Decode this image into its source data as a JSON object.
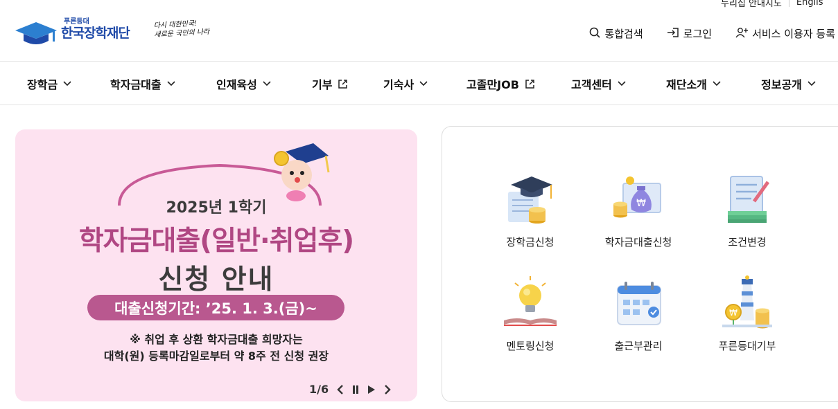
{
  "utility": {
    "sitemap": "누리집 안내지도",
    "english": "Englis"
  },
  "logo": {
    "sub": "푸른등대",
    "main": "한국장학재단",
    "slogan_line1": "다시 대한민국!",
    "slogan_line2": "새로운 국민의 나라"
  },
  "header_menu": {
    "search": "통합검색",
    "login": "로그인",
    "register": "서비스 이용자 등록"
  },
  "nav": {
    "items": [
      {
        "label": "장학금",
        "icon": "chevron-down-icon"
      },
      {
        "label": "학자금대출",
        "icon": "chevron-down-icon"
      },
      {
        "label": "인재육성",
        "icon": "chevron-down-icon"
      },
      {
        "label": "기부",
        "icon": "external-link-icon"
      },
      {
        "label": "기숙사",
        "icon": "chevron-down-icon"
      },
      {
        "label": "고졸만JOB",
        "icon": "external-link-icon"
      },
      {
        "label": "고객센터",
        "icon": "chevron-down-icon"
      },
      {
        "label": "재단소개",
        "icon": "chevron-down-icon"
      },
      {
        "label": "정보공개",
        "icon": "chevron-down-icon"
      }
    ]
  },
  "banner": {
    "year": "2025년 1학기",
    "title": "학자금대출(일반·취업후)",
    "title2": "신청 안내",
    "period": "대출신청기간: ’25. 1. 3.(금)~",
    "note1": "※ 취업 후 상환 학자금대출 희망자는",
    "note2": "대학(원) 등록마감일로부터 약 8주 전 신청 권장",
    "pager": "1/6",
    "background": "#fde2f0",
    "accent": "#b9588f"
  },
  "quick_links": [
    {
      "label": "장학금신청",
      "icon": "graduation-cap-icon"
    },
    {
      "label": "학자금대출신청",
      "icon": "money-bag-icon"
    },
    {
      "label": "조건변경",
      "icon": "document-edit-icon"
    },
    {
      "label": "멘토링신청",
      "icon": "lightbulb-book-icon"
    },
    {
      "label": "출근부관리",
      "icon": "calendar-icon"
    },
    {
      "label": "푸른등대기부",
      "icon": "lighthouse-icon"
    }
  ],
  "colors": {
    "brand_blue": "#1f4aa8",
    "banner_title": "#b04783"
  }
}
